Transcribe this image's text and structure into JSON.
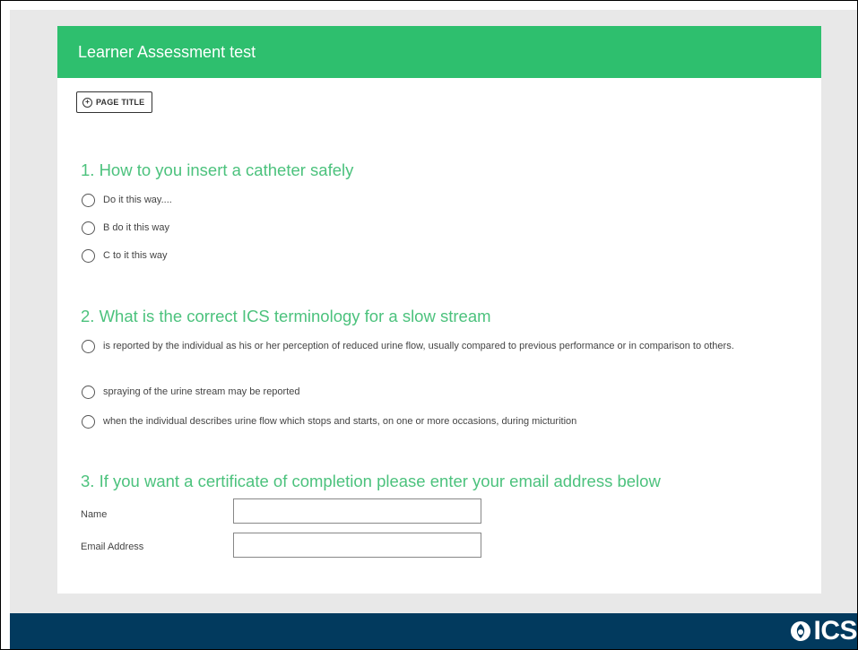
{
  "survey": {
    "title": "Learner Assessment test",
    "page_title_button": "PAGE TITLE"
  },
  "questions": [
    {
      "title": "1. How to you insert a catheter safely",
      "options": [
        "Do it this way....",
        "B do it this way",
        "C to it this way"
      ]
    },
    {
      "title": "2. What is the correct ICS terminology for a slow stream",
      "options": [
        "is reported by the individual as his or her perception of reduced urine flow, usually compared to previous performance or in comparison to others.",
        "spraying of the urine stream may be reported",
        "when the individual describes urine flow which stops and starts, on one or more occasions, during micturition"
      ]
    },
    {
      "title": "3. If you want a certificate of completion please enter your email address below",
      "fields": [
        {
          "label": "Name",
          "value": ""
        },
        {
          "label": "Email Address",
          "value": ""
        }
      ]
    }
  ],
  "footer": {
    "logo_text": "ICS"
  },
  "colors": {
    "header_green": "#2ebf6e",
    "question_green": "#4cc27d",
    "footer_navy": "#023a5e"
  }
}
